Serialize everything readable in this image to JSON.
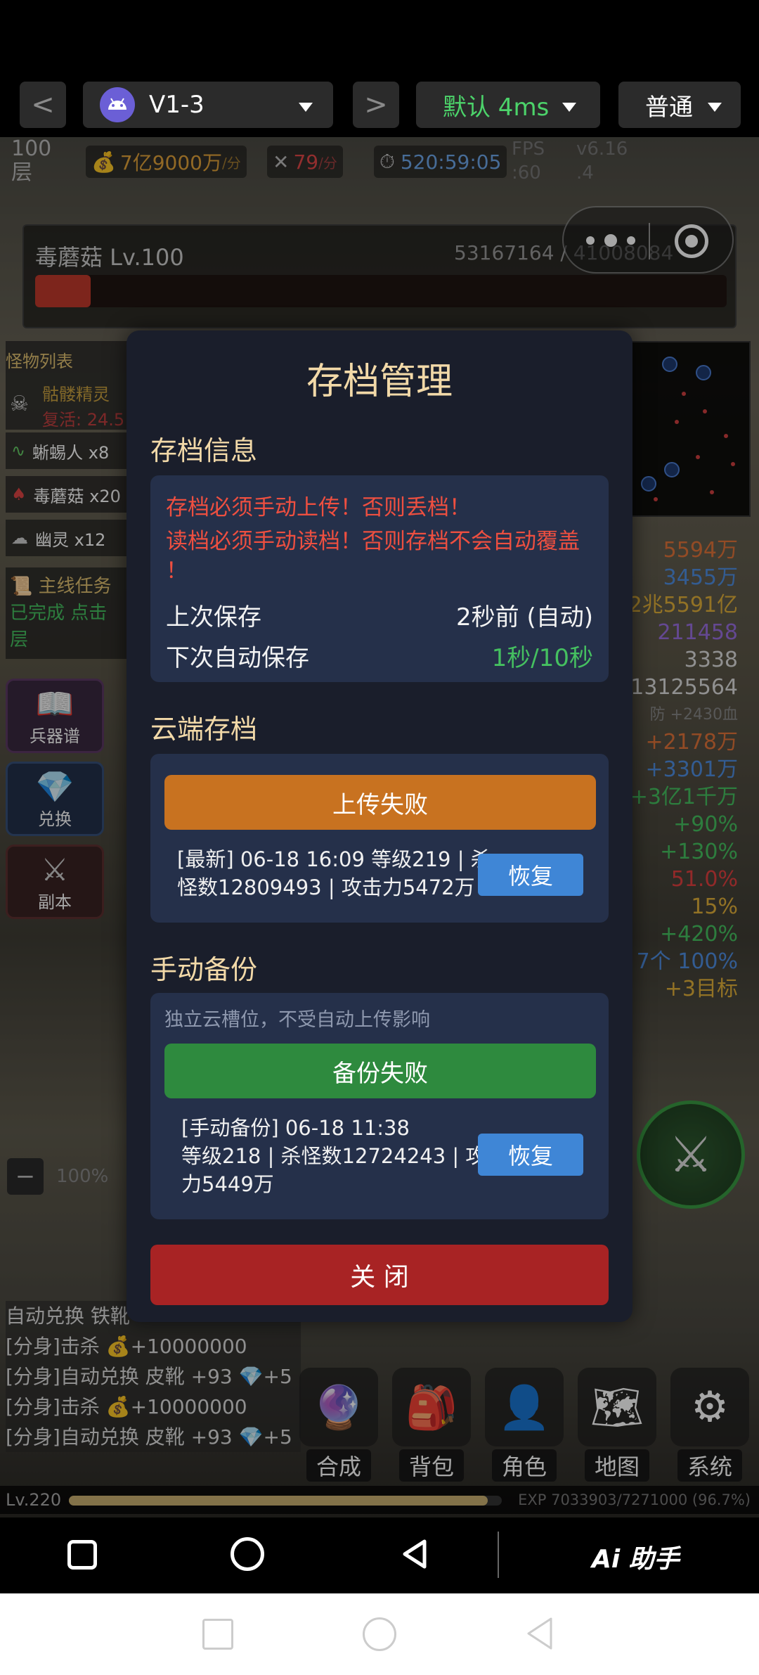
{
  "toolbar": {
    "back": "<",
    "forward": ">",
    "app_name": "V1-3",
    "mode": "默认 4ms",
    "quality": "普通"
  },
  "hud": {
    "floor": "100",
    "floor_unit": "层",
    "gold_rate": "7亿9000万",
    "gold_rate_unit": "/分",
    "kill_rate": "79",
    "kill_rate_unit": "/分",
    "timer": "520:59:05",
    "fps_label": "FPS",
    "fps_value": ":60",
    "version": "v6.16",
    "version_minor": ".4"
  },
  "boss": {
    "name": "毒蘑菇 Lv.100",
    "hp_text": "53167164 / 41008084",
    "hp_fraction": 0.08
  },
  "monster_list": {
    "title": "怪物列表",
    "items": [
      {
        "icon": "skull-icon",
        "label": "骷髅精灵",
        "sub": "复活: 24.5"
      },
      {
        "icon": "worm-icon",
        "label": "蜥蜴人 x8"
      },
      {
        "icon": "mushroom-icon",
        "label": "毒蘑菇 x20"
      },
      {
        "icon": "ghost-icon",
        "label": "幽灵 x12"
      }
    ]
  },
  "quest": {
    "title": "主线任务",
    "status": "已完成 点击",
    "unit": "层"
  },
  "side_buttons": [
    {
      "label": "兵器谱",
      "icon": "book-icon"
    },
    {
      "label": "兑换",
      "icon": "diamond-icon"
    },
    {
      "label": "副本",
      "icon": "swords-icon"
    }
  ],
  "right_stats": [
    {
      "value": "5594万",
      "color": "#e0733a"
    },
    {
      "value": "3455万",
      "color": "#4f8ee0"
    },
    {
      "value": "2兆5591亿",
      "color": "#e0b03a"
    },
    {
      "value": "211458",
      "color": "#9a6fe0"
    },
    {
      "value": "3338",
      "color": "#dddddd"
    },
    {
      "value": "13125564",
      "color": "#dddddd"
    },
    {
      "value": "防 +2430血",
      "color": "#888888"
    },
    {
      "value": "+2178万",
      "color": "#e0733a"
    },
    {
      "value": "+3301万",
      "color": "#4f8ee0"
    },
    {
      "value": "+3亿1千万",
      "color": "#45c060"
    },
    {
      "value": "+90%",
      "color": "#45c060"
    },
    {
      "value": "+130%",
      "color": "#45c060"
    },
    {
      "value": "51.0%",
      "color": "#e04040"
    },
    {
      "value": "15%",
      "color": "#e0b03a"
    },
    {
      "value": "+420%",
      "color": "#45c060"
    },
    {
      "value": "7个 100%",
      "color": "#4f8ee0"
    },
    {
      "value": "+3目标",
      "color": "#e0b03a"
    }
  ],
  "zoom": {
    "minus": "−",
    "value": "100%"
  },
  "log": [
    "自动兑换 铁靴",
    "[分身]击杀 💰+10000000",
    "[分身]自动兑换 皮靴 +93 💎+5",
    "[分身]击杀 💰+10000000",
    "[分身]自动兑换 皮靴 +93 💎+5"
  ],
  "bottom_menu": [
    {
      "label": "合成",
      "icon": "orb-icon"
    },
    {
      "label": "背包",
      "icon": "backpack-icon"
    },
    {
      "label": "角色",
      "icon": "person-icon"
    },
    {
      "label": "地图",
      "icon": "map-icon"
    },
    {
      "label": "系统",
      "icon": "gear-icon"
    }
  ],
  "exp": {
    "level": "Lv.220",
    "text": "EXP 7033903/7271000 (96.7%)",
    "fraction": 0.967
  },
  "modal": {
    "title": "存档管理",
    "info_section": "存档信息",
    "warning_1": "存档必须手动上传！否则丢档！",
    "warning_2": "读档必须手动读档！否则存档不会自动覆盖",
    "warning_3": "！",
    "last_save_label": "上次保存",
    "last_save_value": "2秒前 (自动)",
    "next_save_label": "下次自动保存",
    "next_save_value": "1秒/10秒",
    "cloud_section": "云端存档",
    "upload_button": "上传失败",
    "cloud_record_1": "[最新] 06-18 16:09 等级219 | 杀",
    "cloud_record_2": "怪数12809493 | 攻击力5472万",
    "restore_label": "恢复",
    "manual_section": "手动备份",
    "manual_hint": "独立云槽位，不受自动上传影响",
    "backup_button": "备份失败",
    "manual_record_1": "[手动备份] 06-18 11:38",
    "manual_record_2": "等级218 | 杀怪数12724243 | 攻击",
    "manual_record_3": "力5449万",
    "close_button": "关 闭"
  },
  "colors": {
    "modal_bg": "#1a1e2b",
    "card_bg": "#25304a",
    "title_gold": "#f2d9a8",
    "warning_red": "#ee4f40",
    "success_green": "#45c060",
    "upload_orange": "#c87220",
    "backup_green": "#2e8a3e",
    "close_red": "#a82324",
    "restore_blue": "#3f86d6"
  },
  "nav": {
    "assistant": "Ai 助手"
  }
}
